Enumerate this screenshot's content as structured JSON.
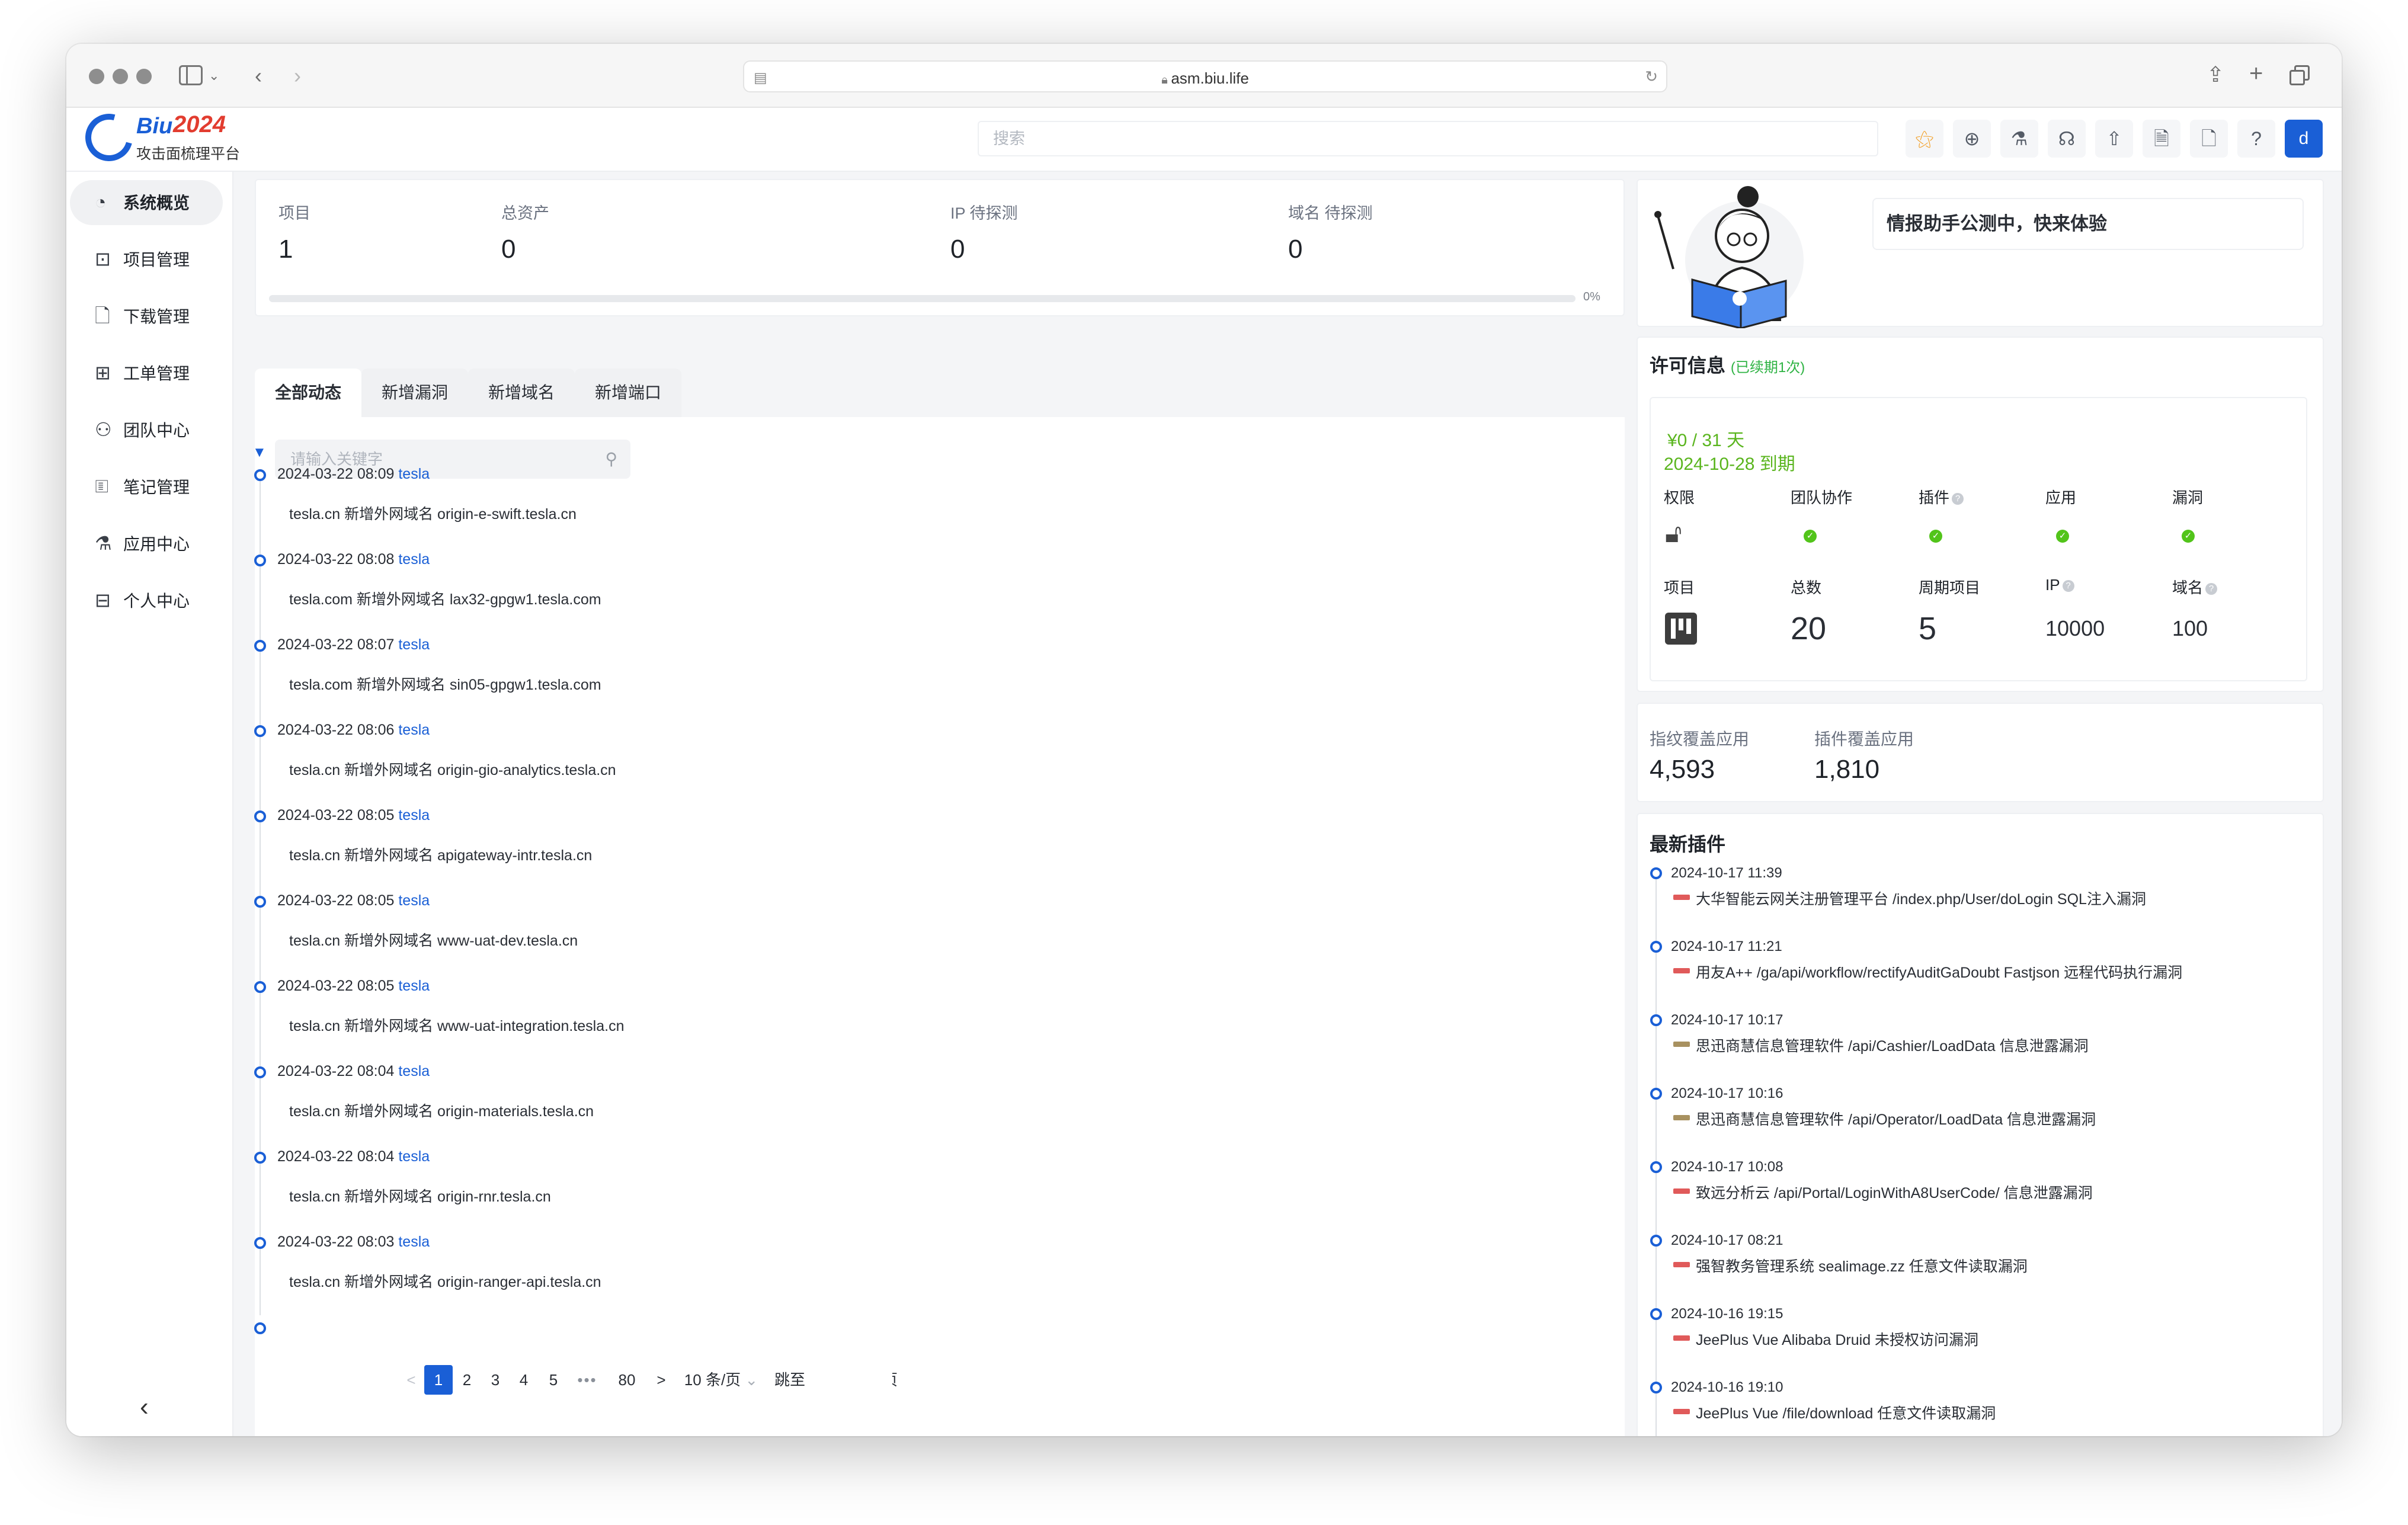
{
  "browser": {
    "url": "asm.biu.life"
  },
  "brand": {
    "name": "Biu",
    "year": "2024",
    "subtitle": "攻击面梳理平台"
  },
  "topbar": {
    "search_placeholder": "搜索",
    "user_initial": "d",
    "icons": [
      "cluster-icon",
      "add-circle-icon",
      "flask-icon",
      "headset-icon",
      "upload-icon",
      "report-icon",
      "document-icon",
      "help-icon"
    ]
  },
  "sidebar": {
    "items": [
      {
        "label": "系统概览",
        "icon": "dashboard-icon"
      },
      {
        "label": "项目管理",
        "icon": "project-icon"
      },
      {
        "label": "下载管理",
        "icon": "file-icon"
      },
      {
        "label": "工单管理",
        "icon": "ticket-icon"
      },
      {
        "label": "团队中心",
        "icon": "team-icon"
      },
      {
        "label": "笔记管理",
        "icon": "markdown-icon"
      },
      {
        "label": "应用中心",
        "icon": "flask-icon"
      },
      {
        "label": "个人中心",
        "icon": "profile-icon"
      }
    ]
  },
  "stats": {
    "items": [
      {
        "label": "项目",
        "value": "1"
      },
      {
        "label": "总资产",
        "value": "0"
      },
      {
        "label": "IP 待探测",
        "value": "0"
      },
      {
        "label": "域名 待探测",
        "value": "0"
      }
    ],
    "progress": 0,
    "progress_label": "0%"
  },
  "tabs": [
    "全部动态",
    "新增漏洞",
    "新增域名",
    "新增端口"
  ],
  "filter": {
    "placeholder": "请输入关键字"
  },
  "timeline": [
    {
      "date": "2024-03-22 08:09",
      "user": "tesla",
      "text": "tesla.cn 新增外网域名 origin-e-swift.tesla.cn"
    },
    {
      "date": "2024-03-22 08:08",
      "user": "tesla",
      "text": "tesla.com 新增外网域名 lax32-gpgw1.tesla.com"
    },
    {
      "date": "2024-03-22 08:07",
      "user": "tesla",
      "text": "tesla.com 新增外网域名 sin05-gpgw1.tesla.com"
    },
    {
      "date": "2024-03-22 08:06",
      "user": "tesla",
      "text": "tesla.cn 新增外网域名 origin-gio-analytics.tesla.cn"
    },
    {
      "date": "2024-03-22 08:05",
      "user": "tesla",
      "text": "tesla.cn 新增外网域名 apigateway-intr.tesla.cn"
    },
    {
      "date": "2024-03-22 08:05",
      "user": "tesla",
      "text": "tesla.cn 新增外网域名 www-uat-dev.tesla.cn"
    },
    {
      "date": "2024-03-22 08:05",
      "user": "tesla",
      "text": "tesla.cn 新增外网域名 www-uat-integration.tesla.cn"
    },
    {
      "date": "2024-03-22 08:04",
      "user": "tesla",
      "text": "tesla.cn 新增外网域名 origin-materials.tesla.cn"
    },
    {
      "date": "2024-03-22 08:04",
      "user": "tesla",
      "text": "tesla.cn 新增外网域名 origin-rnr.tesla.cn"
    },
    {
      "date": "2024-03-22 08:03",
      "user": "tesla",
      "text": "tesla.cn 新增外网域名 origin-ranger-api.tesla.cn"
    }
  ],
  "pagination": {
    "prev": "<",
    "pages": [
      "1",
      "2",
      "3",
      "4",
      "5"
    ],
    "ellipsis": "•••",
    "last": "80",
    "next": ">",
    "current": "1",
    "page_size": "10 条/页",
    "jump_label": "跳至",
    "page_suffix": "页"
  },
  "welcome": {
    "text": "情报助手公测中，快来体验"
  },
  "license": {
    "title": "许可信息",
    "renew_note": "(已续期1次)",
    "price": "¥0 / 31 天",
    "expiry": "2024-10-28 到期",
    "row1_headers": [
      "权限",
      "团队协作",
      "插件",
      "应用",
      "漏洞"
    ],
    "row2_headers": [
      "项目",
      "总数",
      "周期项目",
      "IP",
      "域名"
    ],
    "total": "20",
    "periodic": "5",
    "ip": "10000",
    "domain": "100",
    "status_color": "#52c41a"
  },
  "coverage": {
    "fingerprint_label": "指纹覆盖应用",
    "fingerprint_value": "4,593",
    "plugin_label": "插件覆盖应用",
    "plugin_value": "1,810"
  },
  "plugins": {
    "title": "最新插件",
    "items": [
      {
        "date": "2024-10-17 11:39",
        "title": "大华智能云网关注册管理平台 /index.php/User/doLogin SQL注入漏洞",
        "severity_color": "#e05a5a"
      },
      {
        "date": "2024-10-17 11:21",
        "title": "用友A++ /ga/api/workflow/rectifyAuditGaDoubt Fastjson 远程代码执行漏洞",
        "severity_color": "#e05a5a"
      },
      {
        "date": "2024-10-17 10:17",
        "title": "思迅商慧信息管理软件 /api/Cashier/LoadData 信息泄露漏洞",
        "severity_color": "#a89160"
      },
      {
        "date": "2024-10-17 10:16",
        "title": "思迅商慧信息管理软件 /api/Operator/LoadData 信息泄露漏洞",
        "severity_color": "#a89160"
      },
      {
        "date": "2024-10-17 10:08",
        "title": "致远分析云 /api/Portal/LoginWithA8UserCode/ 信息泄露漏洞",
        "severity_color": "#e05a5a"
      },
      {
        "date": "2024-10-17 08:21",
        "title": "强智教务管理系统 sealimage.zz 任意文件读取漏洞",
        "severity_color": "#e05a5a"
      },
      {
        "date": "2024-10-16 19:15",
        "title": "JeePlus Vue Alibaba Druid 未授权访问漏洞",
        "severity_color": "#e05a5a"
      },
      {
        "date": "2024-10-16 19:10",
        "title": "JeePlus Vue /file/download 任意文件读取漏洞",
        "severity_color": "#e05a5a"
      }
    ]
  }
}
